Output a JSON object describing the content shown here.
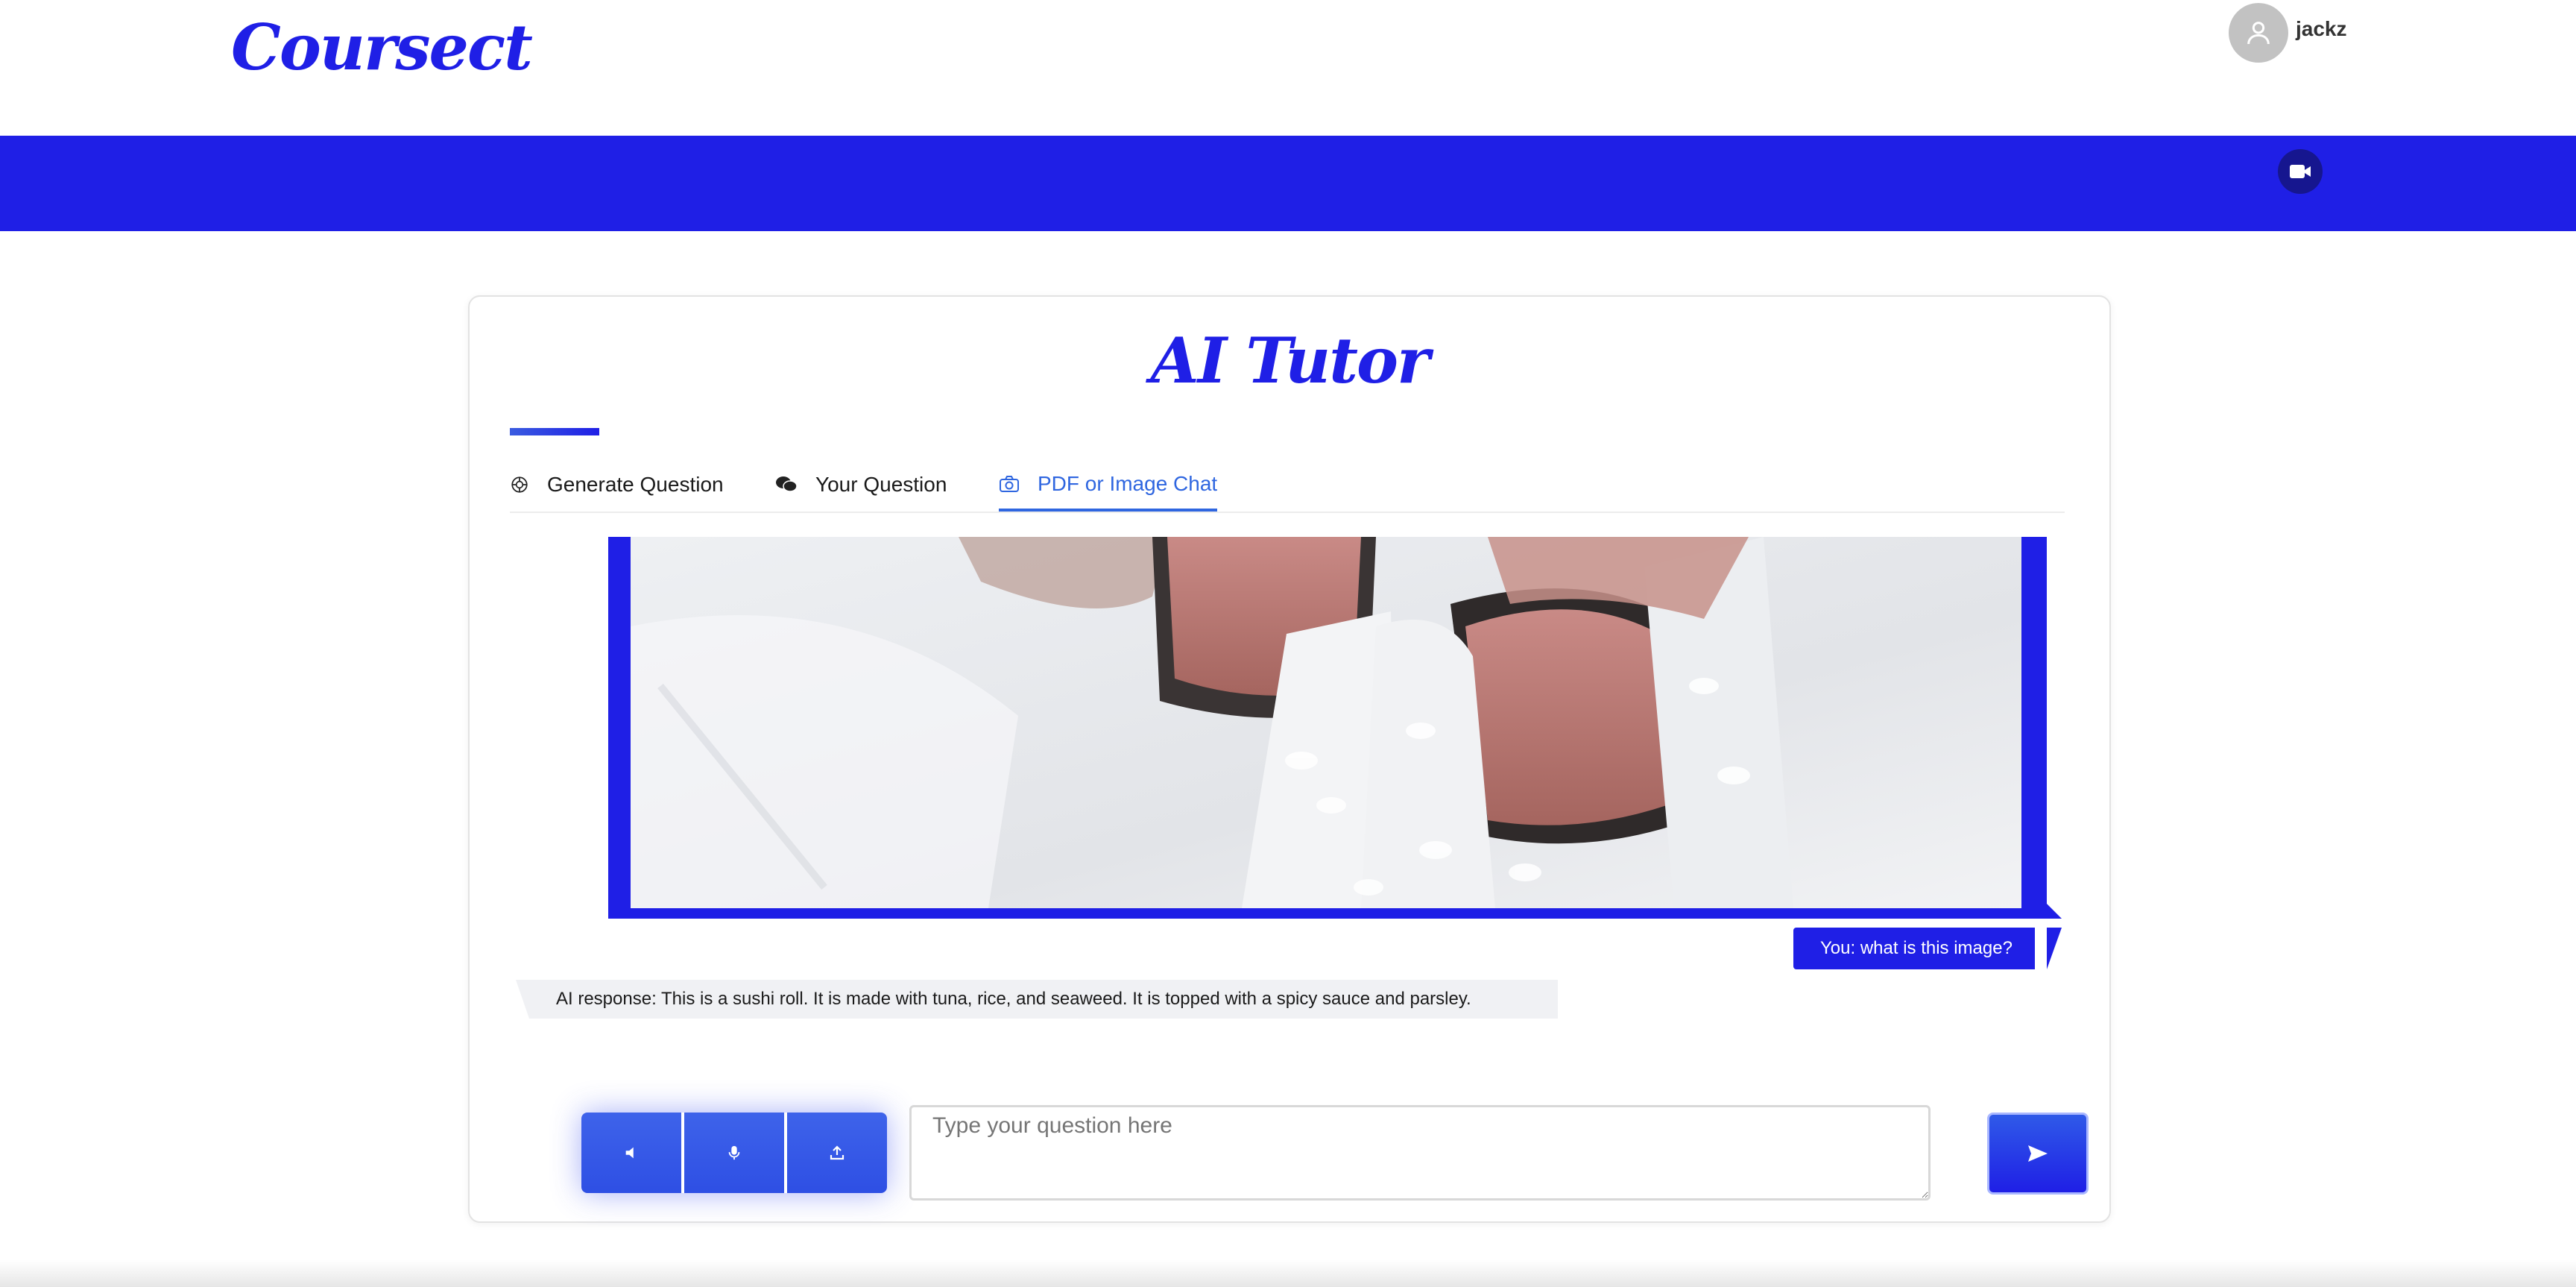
{
  "header": {
    "logo": "Coursect",
    "username": "jackz"
  },
  "card": {
    "title": "AI Tutor",
    "tabs": [
      {
        "label": "Generate Question",
        "icon": "openai-icon",
        "active": false
      },
      {
        "label": "Your Question",
        "icon": "chat-bubbles-icon",
        "active": false
      },
      {
        "label": "PDF or Image Chat",
        "icon": "camera-icon",
        "active": true
      }
    ],
    "image": {
      "subject": "sushi-roll-photo"
    },
    "chat": {
      "user_message": "You: what is this image?",
      "ai_message": "AI response:  This is a sushi roll. It is made with tuna, rice, and seaweed. It is topped with a spicy sauce and parsley."
    },
    "input": {
      "placeholder": "Type your question here",
      "value": ""
    }
  },
  "colors": {
    "brand": "#1f1fe6",
    "active_tab": "#2f66e0",
    "button": "#2e4fe4",
    "ai_bubble": "#f0f1f4"
  }
}
